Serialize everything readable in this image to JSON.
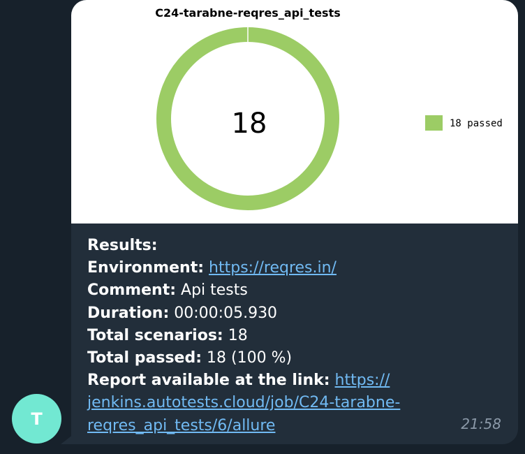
{
  "avatar": {
    "letter": "T",
    "color": "#72e8d2"
  },
  "colors": {
    "bubble": "#222e3a",
    "background": "#17212b",
    "link": "#71baf3",
    "passed": "#9ccc65"
  },
  "chart_data": {
    "type": "pie",
    "title": "C24-tarabne-reqres_api_tests",
    "center_label": "18",
    "slices": [
      {
        "label": "18 passed",
        "value": 18,
        "color": "#9ccc65"
      }
    ],
    "legend": [
      "18 passed"
    ],
    "legend_position": "right"
  },
  "message": {
    "results_label": "Results:",
    "environment_label": "Environment:",
    "environment_link": "https://reqres.in/",
    "comment_label": "Comment:",
    "comment_value": "Api tests",
    "duration_label": "Duration:",
    "duration_value": "00:00:05.930",
    "total_scenarios_label": "Total scenarios:",
    "total_scenarios_value": "18",
    "total_passed_label": "Total passed:",
    "total_passed_value": "18 (100 %)",
    "report_label": "Report available at the link:",
    "report_link_1": "https://",
    "report_link_2": "jenkins.autotests.cloud/job/C24-tarabne-",
    "report_link_3": "reqres_api_tests/6/allure"
  },
  "time": "21:58"
}
